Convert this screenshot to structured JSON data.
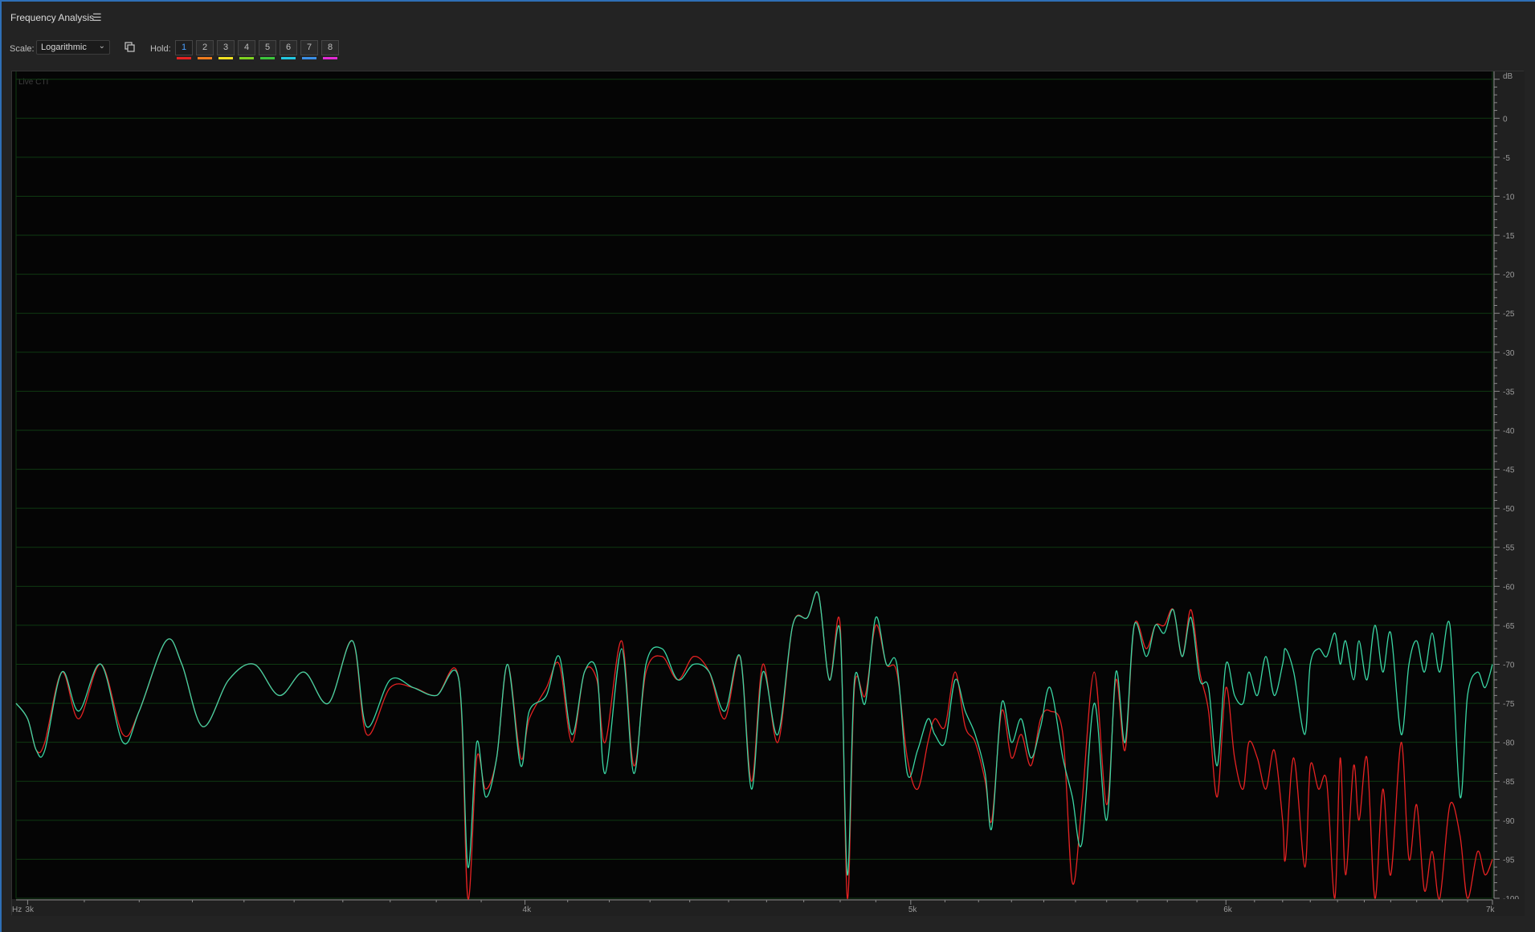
{
  "panel": {
    "title": "Frequency Analysis",
    "menu_icon": "hamburger-menu-icon"
  },
  "toolbar": {
    "scale_label": "Scale:",
    "scale_value": "Logarithmic",
    "overlay_icon": "overlay-toggle-icon",
    "hold_label": "Hold:",
    "hold_buttons": [
      {
        "label": "1",
        "color": "#e52222",
        "active": true
      },
      {
        "label": "2",
        "color": "#f07c1e",
        "active": false
      },
      {
        "label": "3",
        "color": "#f2e322",
        "active": false
      },
      {
        "label": "4",
        "color": "#7ed321",
        "active": false
      },
      {
        "label": "5",
        "color": "#3cc63c",
        "active": false
      },
      {
        "label": "6",
        "color": "#22c7e0",
        "active": false
      },
      {
        "label": "7",
        "color": "#3b8fe6",
        "active": false
      },
      {
        "label": "8",
        "color": "#e22bd5",
        "active": false
      }
    ]
  },
  "chart_data": {
    "type": "line",
    "annotation": "Live CTI",
    "x_unit": "Hz",
    "y_unit": "dB",
    "x_scale": "log",
    "xlim": [
      2980,
      7000
    ],
    "ylim": [
      -100,
      6
    ],
    "x_ticks": [
      {
        "value": 3000,
        "label": "3k"
      },
      {
        "value": 4000,
        "label": "4k"
      },
      {
        "value": 5000,
        "label": "5k"
      },
      {
        "value": 6000,
        "label": "6k"
      },
      {
        "value": 7000,
        "label": "7k"
      }
    ],
    "y_ticks": [
      0,
      -5,
      -10,
      -15,
      -20,
      -25,
      -30,
      -35,
      -40,
      -45,
      -50,
      -55,
      -60,
      -65,
      -70,
      -75,
      -80,
      -85,
      -90,
      -95,
      -100
    ],
    "grid": true,
    "grid_color": "#0f3a12",
    "background": "#050505",
    "series": [
      {
        "color": "#e52222",
        "points": [
          [
            2980,
            -75
          ],
          [
            3000,
            -77
          ],
          [
            3015,
            -81
          ],
          [
            3030,
            -80
          ],
          [
            3060,
            -71
          ],
          [
            3090,
            -77
          ],
          [
            3130,
            -70
          ],
          [
            3170,
            -79
          ],
          [
            3200,
            -76
          ],
          [
            3250,
            -67
          ],
          [
            3280,
            -70
          ],
          [
            3320,
            -78
          ],
          [
            3370,
            -72
          ],
          [
            3420,
            -70
          ],
          [
            3470,
            -74
          ],
          [
            3520,
            -71
          ],
          [
            3570,
            -75
          ],
          [
            3620,
            -67
          ],
          [
            3650,
            -79
          ],
          [
            3700,
            -73
          ],
          [
            3750,
            -73
          ],
          [
            3800,
            -74
          ],
          [
            3850,
            -72
          ],
          [
            3870,
            -100
          ],
          [
            3890,
            -82
          ],
          [
            3910,
            -86
          ],
          [
            3935,
            -82
          ],
          [
            3960,
            -70
          ],
          [
            3990,
            -82
          ],
          [
            4010,
            -77
          ],
          [
            4050,
            -73
          ],
          [
            4080,
            -70
          ],
          [
            4110,
            -80
          ],
          [
            4140,
            -71
          ],
          [
            4170,
            -72
          ],
          [
            4190,
            -80
          ],
          [
            4230,
            -67
          ],
          [
            4260,
            -83
          ],
          [
            4290,
            -71
          ],
          [
            4330,
            -69
          ],
          [
            4370,
            -72
          ],
          [
            4410,
            -69
          ],
          [
            4450,
            -71
          ],
          [
            4490,
            -77
          ],
          [
            4530,
            -69
          ],
          [
            4560,
            -85
          ],
          [
            4590,
            -70
          ],
          [
            4630,
            -80
          ],
          [
            4670,
            -65
          ],
          [
            4710,
            -64
          ],
          [
            4740,
            -61
          ],
          [
            4770,
            -72
          ],
          [
            4800,
            -65
          ],
          [
            4820,
            -100
          ],
          [
            4840,
            -73
          ],
          [
            4870,
            -74
          ],
          [
            4900,
            -65
          ],
          [
            4930,
            -70
          ],
          [
            4960,
            -71
          ],
          [
            4990,
            -82
          ],
          [
            5020,
            -86
          ],
          [
            5050,
            -80
          ],
          [
            5070,
            -77
          ],
          [
            5100,
            -78
          ],
          [
            5130,
            -71
          ],
          [
            5160,
            -78
          ],
          [
            5190,
            -80
          ],
          [
            5220,
            -85
          ],
          [
            5240,
            -90
          ],
          [
            5270,
            -76
          ],
          [
            5300,
            -82
          ],
          [
            5330,
            -79
          ],
          [
            5360,
            -83
          ],
          [
            5390,
            -77
          ],
          [
            5420,
            -76
          ],
          [
            5460,
            -79
          ],
          [
            5490,
            -98
          ],
          [
            5520,
            -88
          ],
          [
            5560,
            -71
          ],
          [
            5600,
            -88
          ],
          [
            5630,
            -72
          ],
          [
            5660,
            -81
          ],
          [
            5690,
            -65
          ],
          [
            5730,
            -68
          ],
          [
            5760,
            -65
          ],
          [
            5790,
            -65
          ],
          [
            5820,
            -63
          ],
          [
            5850,
            -69
          ],
          [
            5880,
            -63
          ],
          [
            5910,
            -71
          ],
          [
            5940,
            -76
          ],
          [
            5970,
            -87
          ],
          [
            6000,
            -73
          ],
          [
            6030,
            -82
          ],
          [
            6060,
            -86
          ],
          [
            6080,
            -80
          ],
          [
            6110,
            -82
          ],
          [
            6140,
            -86
          ],
          [
            6170,
            -81
          ],
          [
            6200,
            -90
          ],
          [
            6210,
            -95
          ],
          [
            6240,
            -82
          ],
          [
            6280,
            -96
          ],
          [
            6300,
            -83
          ],
          [
            6330,
            -86
          ],
          [
            6360,
            -85
          ],
          [
            6390,
            -100
          ],
          [
            6410,
            -82
          ],
          [
            6430,
            -97
          ],
          [
            6460,
            -83
          ],
          [
            6480,
            -90
          ],
          [
            6510,
            -82
          ],
          [
            6540,
            -100
          ],
          [
            6570,
            -86
          ],
          [
            6600,
            -97
          ],
          [
            6640,
            -80
          ],
          [
            6670,
            -95
          ],
          [
            6700,
            -88
          ],
          [
            6730,
            -99
          ],
          [
            6760,
            -94
          ],
          [
            6790,
            -100
          ],
          [
            6830,
            -88
          ],
          [
            6870,
            -92
          ],
          [
            6900,
            -100
          ],
          [
            6940,
            -94
          ],
          [
            6970,
            -97
          ],
          [
            7000,
            -95
          ]
        ]
      },
      {
        "color": "#3ad6a4",
        "points": [
          [
            2980,
            -75
          ],
          [
            3000,
            -77
          ],
          [
            3015,
            -81
          ],
          [
            3030,
            -81
          ],
          [
            3060,
            -71
          ],
          [
            3090,
            -76
          ],
          [
            3130,
            -70
          ],
          [
            3170,
            -80
          ],
          [
            3200,
            -76
          ],
          [
            3250,
            -67
          ],
          [
            3280,
            -70
          ],
          [
            3320,
            -78
          ],
          [
            3370,
            -72
          ],
          [
            3420,
            -70
          ],
          [
            3470,
            -74
          ],
          [
            3520,
            -71
          ],
          [
            3570,
            -75
          ],
          [
            3620,
            -67
          ],
          [
            3650,
            -78
          ],
          [
            3700,
            -72
          ],
          [
            3750,
            -73
          ],
          [
            3800,
            -74
          ],
          [
            3850,
            -72
          ],
          [
            3870,
            -96
          ],
          [
            3890,
            -80
          ],
          [
            3910,
            -87
          ],
          [
            3935,
            -82
          ],
          [
            3960,
            -70
          ],
          [
            3990,
            -83
          ],
          [
            4010,
            -76
          ],
          [
            4050,
            -74
          ],
          [
            4080,
            -69
          ],
          [
            4110,
            -79
          ],
          [
            4140,
            -71
          ],
          [
            4170,
            -71
          ],
          [
            4190,
            -84
          ],
          [
            4230,
            -68
          ],
          [
            4260,
            -84
          ],
          [
            4290,
            -70
          ],
          [
            4330,
            -68
          ],
          [
            4370,
            -72
          ],
          [
            4410,
            -70
          ],
          [
            4450,
            -71
          ],
          [
            4490,
            -76
          ],
          [
            4530,
            -69
          ],
          [
            4560,
            -86
          ],
          [
            4590,
            -71
          ],
          [
            4630,
            -79
          ],
          [
            4670,
            -65
          ],
          [
            4710,
            -64
          ],
          [
            4740,
            -61
          ],
          [
            4770,
            -72
          ],
          [
            4800,
            -66
          ],
          [
            4820,
            -97
          ],
          [
            4840,
            -72
          ],
          [
            4870,
            -75
          ],
          [
            4900,
            -64
          ],
          [
            4930,
            -70
          ],
          [
            4960,
            -70
          ],
          [
            4990,
            -84
          ],
          [
            5020,
            -81
          ],
          [
            5050,
            -77
          ],
          [
            5070,
            -79
          ],
          [
            5100,
            -80
          ],
          [
            5130,
            -72
          ],
          [
            5160,
            -76
          ],
          [
            5190,
            -79
          ],
          [
            5220,
            -84
          ],
          [
            5240,
            -91
          ],
          [
            5270,
            -75
          ],
          [
            5300,
            -80
          ],
          [
            5330,
            -77
          ],
          [
            5360,
            -82
          ],
          [
            5390,
            -78
          ],
          [
            5420,
            -73
          ],
          [
            5460,
            -82
          ],
          [
            5490,
            -87
          ],
          [
            5520,
            -93
          ],
          [
            5560,
            -75
          ],
          [
            5600,
            -90
          ],
          [
            5630,
            -71
          ],
          [
            5660,
            -80
          ],
          [
            5690,
            -65
          ],
          [
            5730,
            -69
          ],
          [
            5760,
            -65
          ],
          [
            5790,
            -66
          ],
          [
            5820,
            -63
          ],
          [
            5850,
            -69
          ],
          [
            5880,
            -64
          ],
          [
            5910,
            -72
          ],
          [
            5940,
            -73
          ],
          [
            5970,
            -83
          ],
          [
            6000,
            -70
          ],
          [
            6030,
            -74
          ],
          [
            6060,
            -75
          ],
          [
            6080,
            -71
          ],
          [
            6110,
            -74
          ],
          [
            6140,
            -69
          ],
          [
            6170,
            -74
          ],
          [
            6200,
            -70
          ],
          [
            6210,
            -68
          ],
          [
            6240,
            -71
          ],
          [
            6280,
            -79
          ],
          [
            6300,
            -70
          ],
          [
            6330,
            -68
          ],
          [
            6360,
            -69
          ],
          [
            6390,
            -66
          ],
          [
            6410,
            -70
          ],
          [
            6430,
            -67
          ],
          [
            6460,
            -72
          ],
          [
            6480,
            -67
          ],
          [
            6510,
            -72
          ],
          [
            6540,
            -65
          ],
          [
            6570,
            -71
          ],
          [
            6600,
            -66
          ],
          [
            6640,
            -79
          ],
          [
            6670,
            -70
          ],
          [
            6700,
            -67
          ],
          [
            6730,
            -71
          ],
          [
            6760,
            -66
          ],
          [
            6790,
            -71
          ],
          [
            6830,
            -65
          ],
          [
            6870,
            -87
          ],
          [
            6900,
            -74
          ],
          [
            6940,
            -71
          ],
          [
            6970,
            -73
          ],
          [
            7000,
            -70
          ]
        ]
      }
    ]
  }
}
